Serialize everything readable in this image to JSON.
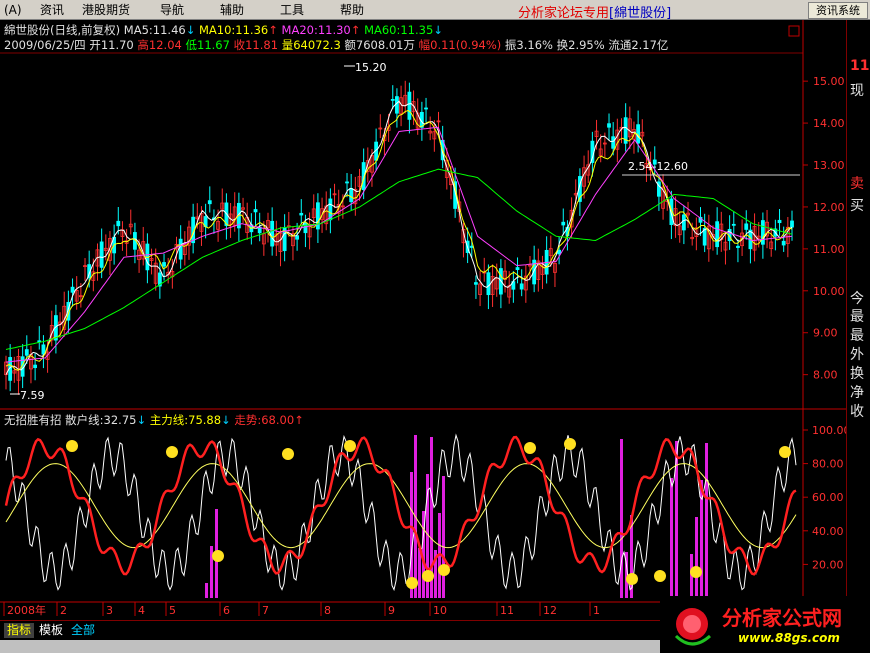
{
  "menu": {
    "items": [
      "(A)",
      "资讯",
      "港股期货",
      "导航",
      "辅助",
      "工具",
      "帮助"
    ],
    "brand_text": "分析家论坛专用",
    "brand_stock": "[綿世股份]",
    "info_button": "资讯系统"
  },
  "header1": {
    "name": "綿世股份(日线,前复权)",
    "ma5": "MA5:11.46",
    "ma10": "MA10:11.36",
    "ma20": "MA20:11.30",
    "ma60": "MA60:11.35"
  },
  "header2": {
    "date": "2009/06/25/四",
    "open": "开11.70",
    "high": "高12.04",
    "low": "低11.67",
    "close": "收11.81",
    "volume": "量64072.3",
    "amount": "额7608.01万",
    "change": "幅0.11(0.94%)",
    "amplitude": "振3.16%",
    "turnover": "换2.95%",
    "float": "流通2.17亿"
  },
  "annotations": {
    "high_mark": "15.20",
    "low_mark": "7.59",
    "line_label": "2.54-12.60"
  },
  "price_axis": [
    "15.00",
    "14.00",
    "13.00",
    "12.00",
    "11.00",
    "10.00",
    "9.00",
    "8.00"
  ],
  "indicator_header": {
    "name": "无招胜有招",
    "retail": "散户线:32.75",
    "main": "主力线:75.88",
    "trend": "走势:68.00"
  },
  "indicator_axis": [
    "100.00",
    "80.00",
    "60.00",
    "40.00",
    "20.00"
  ],
  "months": [
    "2008年",
    "2",
    "3",
    "4",
    "5",
    "6",
    "7",
    "8",
    "9",
    "10",
    "11",
    "12",
    "1"
  ],
  "right_panel": [
    "11",
    "现",
    "卖",
    "买",
    "今",
    "最",
    "最",
    "外",
    "换",
    "净",
    "收"
  ],
  "tabs": [
    "指标",
    "模板",
    "全部"
  ],
  "logo": {
    "text": "分析家公式网",
    "url": "www.88gs.com"
  },
  "colors": {
    "bg": "#000000",
    "up": "#ff3030",
    "down": "#00ffff",
    "ma5": "#ffffff",
    "ma10": "#ffff00",
    "ma20": "#ff40ff",
    "ma60": "#00ff00"
  },
  "chart_data": {
    "type": "line",
    "series": [
      {
        "name": "MA5",
        "values": [
          8.0,
          8.6,
          10.3,
          11.5,
          10.3,
          11.8,
          11.8,
          11.2,
          11.8,
          12.5,
          14.6,
          13.8,
          10.2,
          10.2,
          10.8,
          13.5,
          13.9,
          11.7,
          11.3,
          11.3,
          11.4
        ]
      },
      {
        "name": "MA10",
        "values": [
          8.1,
          8.5,
          10.0,
          11.3,
          10.6,
          11.6,
          11.7,
          11.3,
          11.7,
          12.4,
          14.3,
          13.8,
          10.6,
          10.3,
          10.8,
          13.0,
          13.8,
          11.9,
          11.3,
          11.2,
          11.4
        ]
      },
      {
        "name": "MA20",
        "values": [
          8.3,
          8.4,
          9.5,
          10.8,
          10.9,
          11.3,
          11.6,
          11.4,
          11.6,
          12.2,
          13.8,
          13.9,
          11.3,
          10.6,
          10.7,
          12.3,
          13.6,
          12.2,
          11.5,
          11.2,
          11.3
        ]
      },
      {
        "name": "MA60",
        "values": [
          8.6,
          8.8,
          9.1,
          9.6,
          10.2,
          10.8,
          11.2,
          11.5,
          11.6,
          12.0,
          12.6,
          12.9,
          12.7,
          11.9,
          11.3,
          11.2,
          11.7,
          12.3,
          12.2,
          11.6,
          11.35
        ]
      }
    ],
    "ylim": [
      7.3,
      15.6
    ]
  }
}
